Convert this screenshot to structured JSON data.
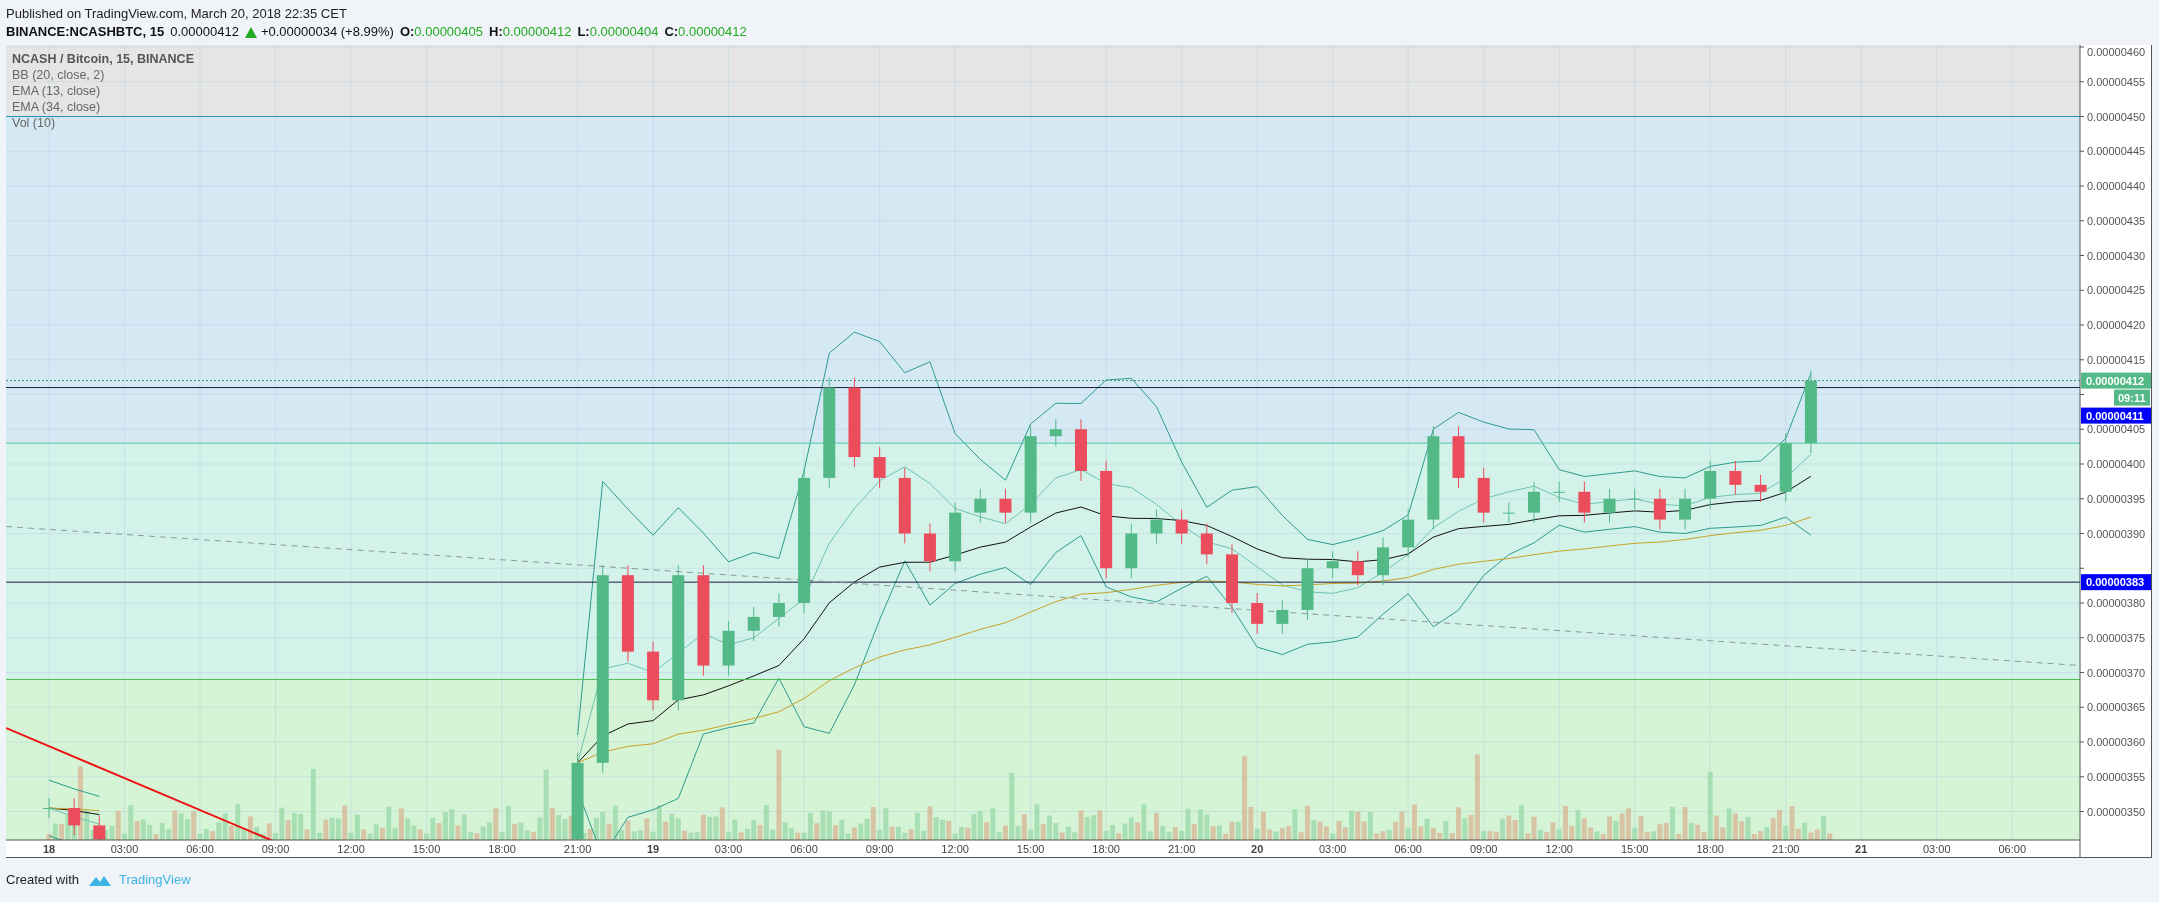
{
  "header": {
    "published": "Published on TradingView.com, March 20, 2018 22:35 CET",
    "symbol": "BINANCE:NCASHBTC, 15",
    "last": "0.00000412",
    "rising": true,
    "change": "+0.00000034 (+8.99%)",
    "ohlc": [
      {
        "label": "O:",
        "value": "0.00000405"
      },
      {
        "label": "H:",
        "value": "0.00000412"
      },
      {
        "label": "L:",
        "value": "0.00000404"
      },
      {
        "label": "C:",
        "value": "0.00000412"
      }
    ]
  },
  "legend": {
    "title": "NCASH / Bitcoin, 15, BINANCE",
    "studies": [
      "BB (20, close, 2)",
      "EMA (13, close)",
      "EMA (34, close)",
      "Vol (10)"
    ]
  },
  "chart": {
    "price_axis": [
      "0.00000460",
      "0.00000455",
      "0.00000450",
      "0.00000445",
      "0.00000440",
      "0.00000435",
      "0.00000430",
      "0.00000425",
      "0.00000420",
      "0.00000415",
      "0.00000405",
      "0.00000400",
      "0.00000395",
      "0.00000390",
      "0.00000380",
      "0.00000375",
      "0.00000370",
      "0.00000365",
      "0.00000360",
      "0.00000355",
      "0.00000350"
    ],
    "time_axis": [
      {
        "label": "18",
        "kind": "day"
      },
      {
        "label": "03:00",
        "kind": "time"
      },
      {
        "label": "06:00",
        "kind": "time"
      },
      {
        "label": "09:00",
        "kind": "time"
      },
      {
        "label": "12:00",
        "kind": "time"
      },
      {
        "label": "15:00",
        "kind": "time"
      },
      {
        "label": "18:00",
        "kind": "time"
      },
      {
        "label": "21:00",
        "kind": "time"
      },
      {
        "label": "19",
        "kind": "day"
      },
      {
        "label": "03:00",
        "kind": "time"
      },
      {
        "label": "06:00",
        "kind": "time"
      },
      {
        "label": "09:00",
        "kind": "time"
      },
      {
        "label": "12:00",
        "kind": "time"
      },
      {
        "label": "15:00",
        "kind": "time"
      },
      {
        "label": "18:00",
        "kind": "time"
      },
      {
        "label": "21:00",
        "kind": "time"
      },
      {
        "label": "20",
        "kind": "day"
      },
      {
        "label": "03:00",
        "kind": "time"
      },
      {
        "label": "06:00",
        "kind": "time"
      },
      {
        "label": "09:00",
        "kind": "time"
      },
      {
        "label": "12:00",
        "kind": "time"
      },
      {
        "label": "15:00",
        "kind": "time"
      },
      {
        "label": "18:00",
        "kind": "time"
      },
      {
        "label": "21:00",
        "kind": "time"
      },
      {
        "label": "21",
        "kind": "day"
      },
      {
        "label": "03:00",
        "kind": "time"
      },
      {
        "label": "06:00",
        "kind": "time"
      }
    ],
    "price_tags": [
      {
        "label": "0.00000412",
        "color": "#53b987",
        "countdown": "09:11"
      },
      {
        "label": "0.00000411",
        "color": "#0000ff"
      },
      {
        "label": "0.00000383",
        "color": "#0000ff"
      }
    ]
  },
  "footer": {
    "created_with": "Created with",
    "brand": "TradingView"
  }
}
